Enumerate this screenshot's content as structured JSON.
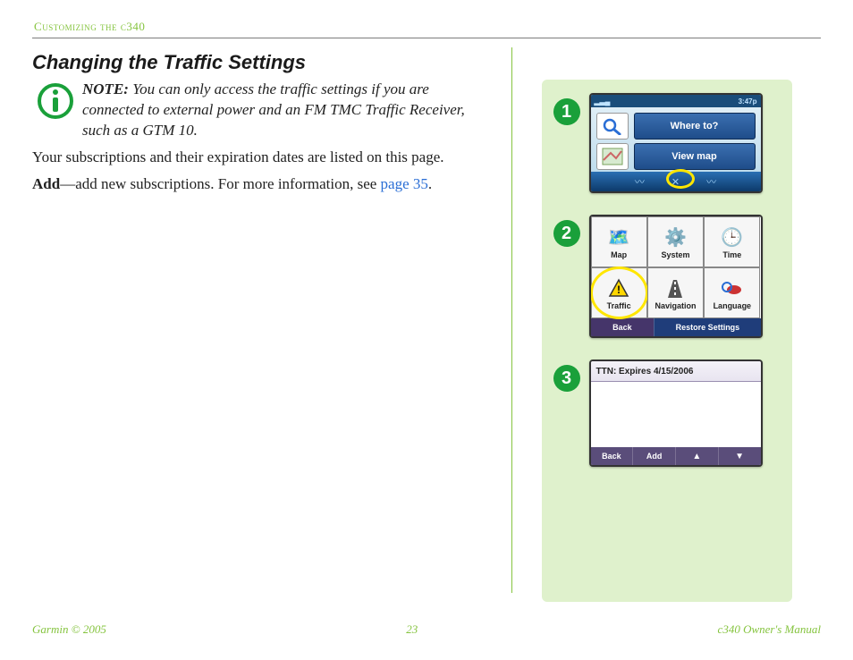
{
  "header": {
    "running_head": "Customizing the c340"
  },
  "main": {
    "title": "Changing the Traffic Settings",
    "note_label": "NOTE:",
    "note_body": " You can only access the traffic settings if you are connected to external power and an FM TMC Traffic Receiver, such as a GTM 10.",
    "para1": "Your subscriptions and their expiration dates are listed on this page.",
    "add_term": "Add",
    "add_dash": "—",
    "add_desc": "add new subscriptions. For more information, see ",
    "add_link": "page 35",
    "add_tail": "."
  },
  "steps": {
    "b1": "1",
    "b2": "2",
    "b3": "3"
  },
  "screen1": {
    "signal": "▂▃▄",
    "time": "3:47p",
    "btn_where": "Where to?",
    "btn_viewmap": "View map"
  },
  "screen2": {
    "cells": [
      "Map",
      "System",
      "Time",
      "Traffic",
      "Navigation",
      "Language"
    ],
    "back": "Back",
    "restore": "Restore Settings"
  },
  "screen3": {
    "row": "TTN: Expires 4/15/2006",
    "back": "Back",
    "add": "Add",
    "up": "▲",
    "down": "▼"
  },
  "footer": {
    "left": "Garmin © 2005",
    "center": "23",
    "right": "c340 Owner's Manual"
  }
}
